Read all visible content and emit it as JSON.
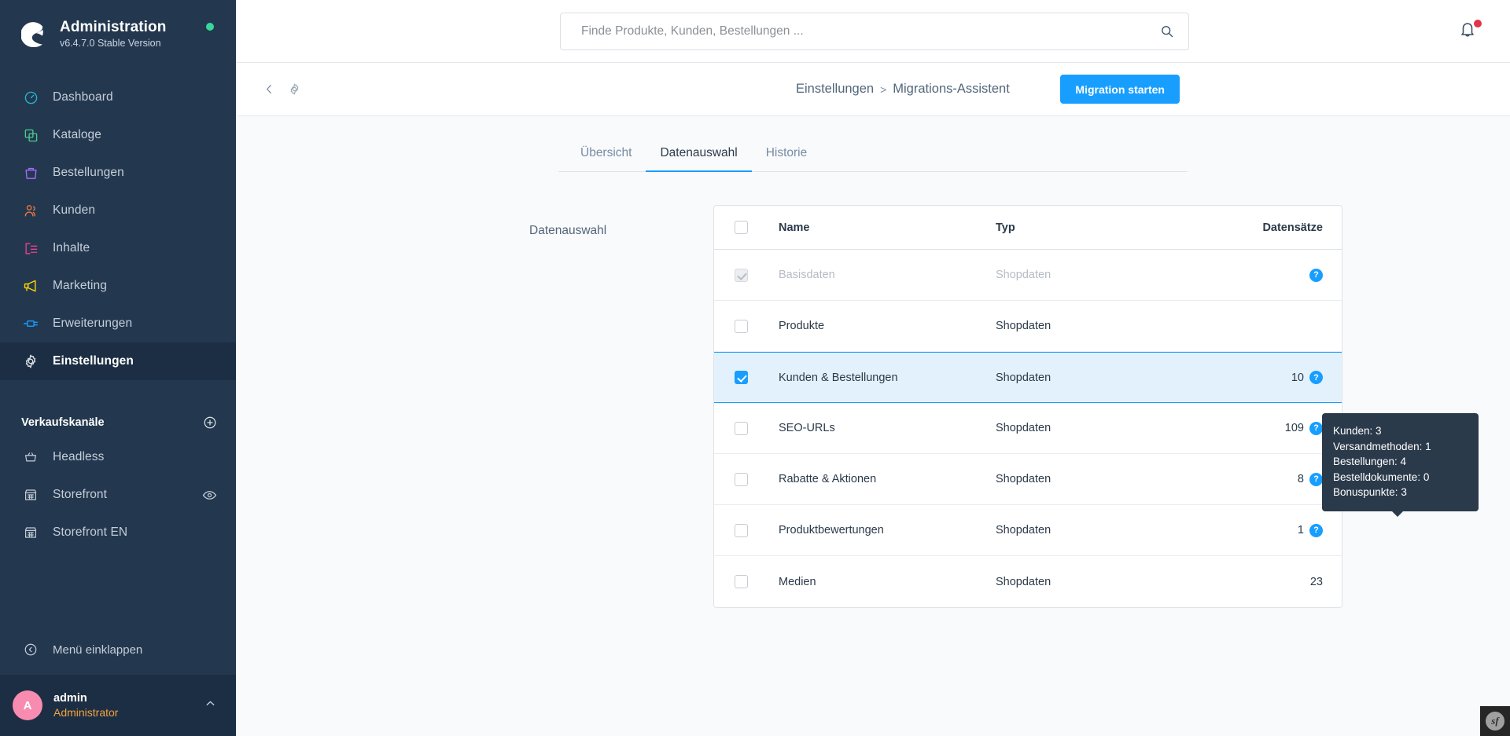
{
  "sidebar": {
    "title": "Administration",
    "version": "v6.4.7.0 Stable Version",
    "status_dot_color": "#37d79c",
    "nav": [
      {
        "label": "Dashboard",
        "icon": "dashboard-icon",
        "color": "#26b6cf",
        "active": false
      },
      {
        "label": "Kataloge",
        "icon": "catalog-icon",
        "color": "#4ccb8e",
        "active": false
      },
      {
        "label": "Bestellungen",
        "icon": "orders-icon",
        "color": "#a66bff",
        "active": false
      },
      {
        "label": "Kunden",
        "icon": "customers-icon",
        "color": "#f0763f",
        "active": false
      },
      {
        "label": "Inhalte",
        "icon": "content-icon",
        "color": "#ee3f8e",
        "active": false
      },
      {
        "label": "Marketing",
        "icon": "marketing-icon",
        "color": "#ffd500",
        "active": false
      },
      {
        "label": "Erweiterungen",
        "icon": "extensions-icon",
        "color": "#189eff",
        "active": false
      },
      {
        "label": "Einstellungen",
        "icon": "gear-icon",
        "color": "#d8dde3",
        "active": true
      }
    ],
    "section_title": "Verkaufskanäle",
    "add_channel_icon": "plus-circle-icon",
    "channels": [
      {
        "label": "Headless",
        "icon": "basket-icon",
        "has_eye": false
      },
      {
        "label": "Storefront",
        "icon": "store-icon",
        "has_eye": true
      },
      {
        "label": "Storefront EN",
        "icon": "store-icon",
        "has_eye": false
      }
    ],
    "collapse_label": "Menü einklappen",
    "collapse_icon": "chevron-left-circle-icon",
    "user": {
      "avatar_initial": "A",
      "avatar_color": "#f88cb0",
      "name": "admin",
      "role": "Administrator",
      "role_color": "#f1a340",
      "chevron_icon": "chevron-up-icon"
    }
  },
  "topbar": {
    "search_placeholder": "Finde Produkte, Kunden, Bestellungen ...",
    "search_value": "",
    "search_icon": "search-icon",
    "bell_icon": "bell-icon",
    "bell_has_notification": true,
    "bell_dot_color": "#e3324b"
  },
  "smartbar": {
    "back_icon": "chevron-left-icon",
    "gear_icon": "gear-icon",
    "breadcrumb": {
      "parent": "Einstellungen",
      "separator": ">",
      "current": "Migrations-Assistent"
    },
    "primary_button": "Migration starten",
    "primary_button_color": "#189eff"
  },
  "tabs": [
    {
      "label": "Übersicht",
      "active": false
    },
    {
      "label": "Datenauswahl",
      "active": true
    },
    {
      "label": "Historie",
      "active": false
    }
  ],
  "section": {
    "label": "Datenauswahl"
  },
  "table": {
    "columns": {
      "select": "",
      "name": "Name",
      "type": "Typ",
      "records": "Datensätze"
    },
    "header_checked": false,
    "rows": [
      {
        "name": "Basisdaten",
        "type": "Shopdaten",
        "records": "",
        "checked": true,
        "disabled": true,
        "selected": false,
        "has_help": true
      },
      {
        "name": "Produkte",
        "type": "Shopdaten",
        "records": "",
        "checked": false,
        "disabled": false,
        "selected": false,
        "has_help": false
      },
      {
        "name": "Kunden & Bestellungen",
        "type": "Shopdaten",
        "records": "10",
        "checked": true,
        "disabled": false,
        "selected": true,
        "has_help": true
      },
      {
        "name": "SEO-URLs",
        "type": "Shopdaten",
        "records": "109",
        "checked": false,
        "disabled": false,
        "selected": false,
        "has_help": true
      },
      {
        "name": "Rabatte & Aktionen",
        "type": "Shopdaten",
        "records": "8",
        "checked": false,
        "disabled": false,
        "selected": false,
        "has_help": true
      },
      {
        "name": "Produktbewertungen",
        "type": "Shopdaten",
        "records": "1",
        "checked": false,
        "disabled": false,
        "selected": false,
        "has_help": true
      },
      {
        "name": "Medien",
        "type": "Shopdaten",
        "records": "23",
        "checked": false,
        "disabled": false,
        "selected": false,
        "has_help": false
      }
    ]
  },
  "tooltip": {
    "lines": [
      "Kunden: 3",
      "Versandmethoden: 1",
      "Bestellungen: 4",
      "Bestelldokumente: 0",
      "Bonuspunkte: 3"
    ]
  },
  "debug_toolbar": {
    "label": "sf",
    "icon": "symfony-icon"
  }
}
